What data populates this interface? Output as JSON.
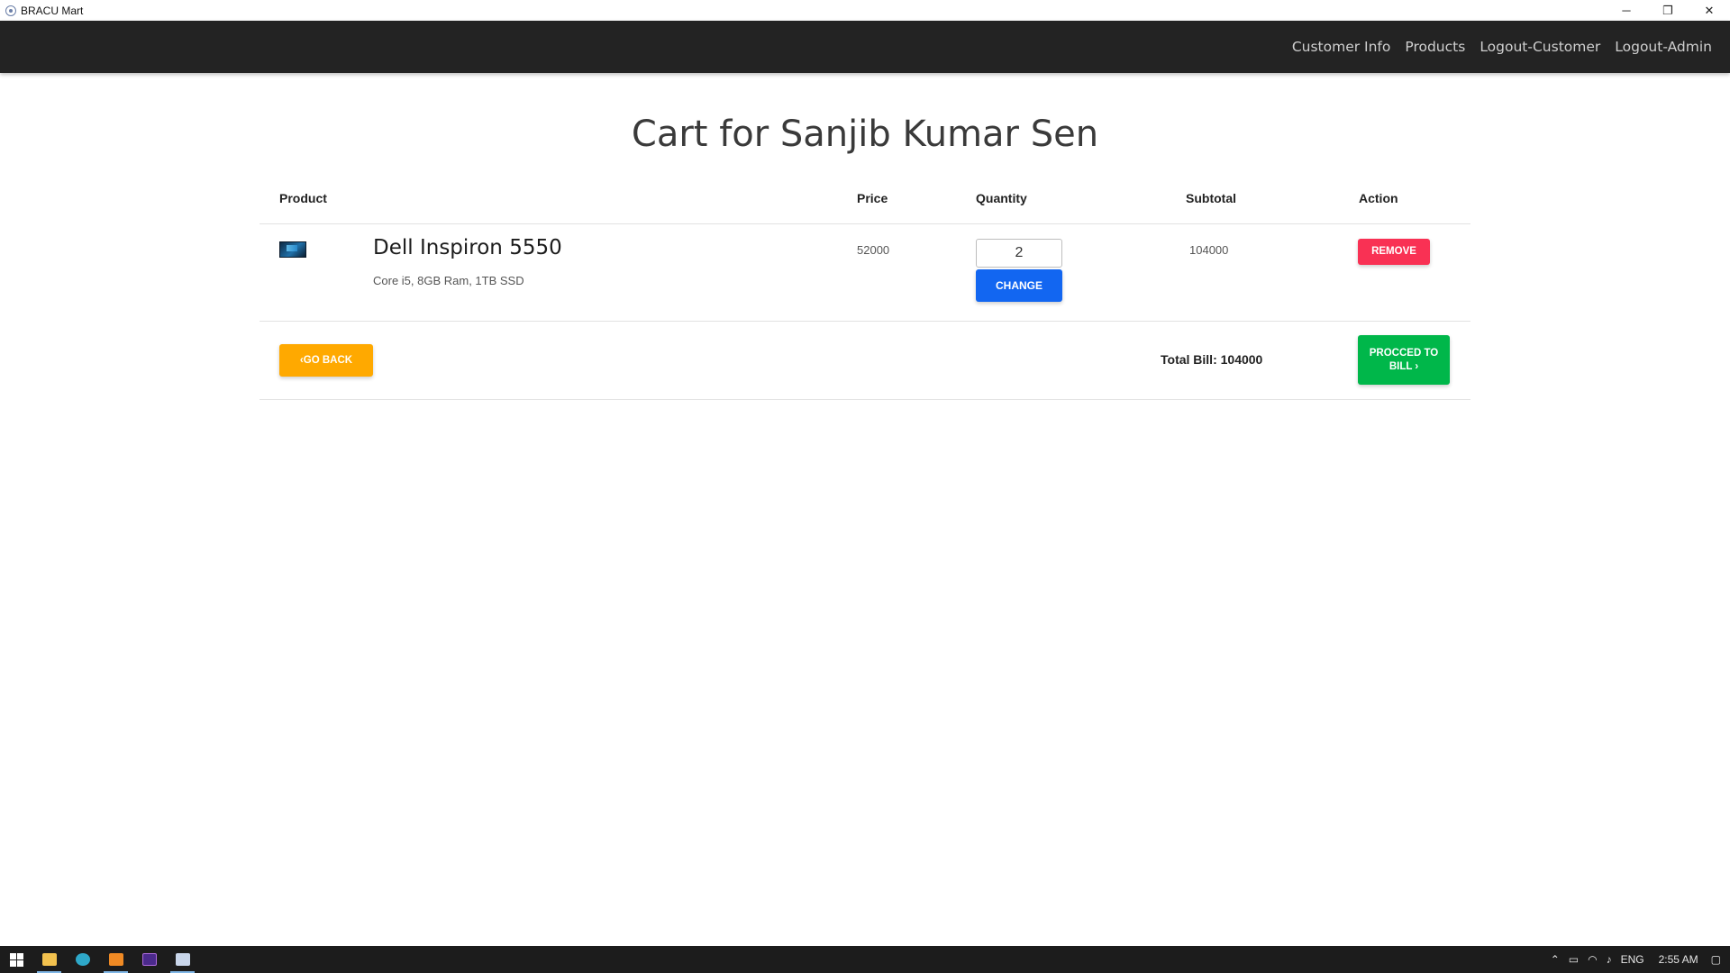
{
  "window": {
    "title": "BRACU Mart",
    "minimize": "─",
    "restore": "❐",
    "close": "✕"
  },
  "navbar": {
    "links": [
      "Customer Info",
      "Products",
      "Logout-Customer",
      "Logout-Admin"
    ]
  },
  "page": {
    "title": "Cart for Sanjib Kumar Sen"
  },
  "cart": {
    "headers": {
      "product": "Product",
      "price": "Price",
      "quantity": "Quantity",
      "subtotal": "Subtotal",
      "action": "Action"
    },
    "items": [
      {
        "name": "Dell Inspiron 5550",
        "description": "Core i5, 8GB Ram, 1TB SSD",
        "price": "52000",
        "quantity": "2",
        "subtotal": "104000",
        "change_label": "CHANGE",
        "remove_label": "REMOVE"
      }
    ],
    "go_back_label": "‹GO BACK",
    "total_bill": "Total Bill: 104000",
    "proceed_label": "PROCCED TO BILL ›"
  },
  "taskbar": {
    "apps": [
      "start",
      "file-explorer",
      "edge",
      "sublime-text",
      "phpstorm",
      "bracu-mart"
    ],
    "tray": {
      "language": "ENG",
      "time": "2:55 AM"
    }
  },
  "colors": {
    "navbar": "#232323",
    "change": "#1266f1",
    "remove": "#f93154",
    "go_back": "#ffa900",
    "proceed": "#00b74a"
  }
}
